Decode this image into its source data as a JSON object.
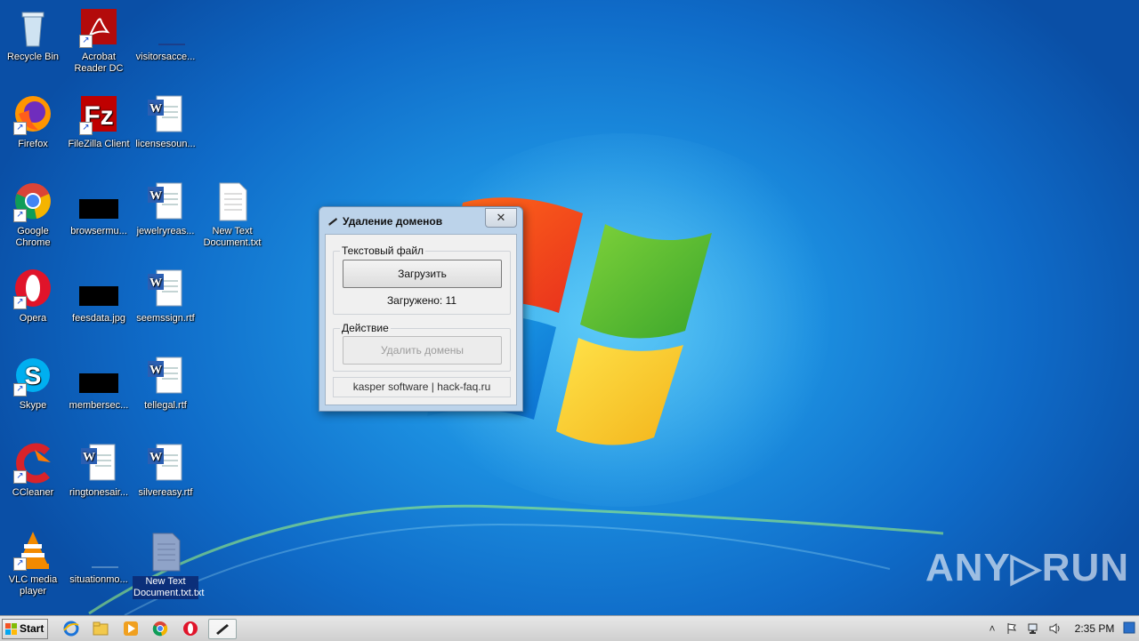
{
  "desktop": {
    "icons": [
      {
        "id": "recycle-bin",
        "label": "Recycle Bin",
        "icon": "recycle-bin-icon",
        "shortcut": false
      },
      {
        "id": "acrobat",
        "label": "Acrobat Reader DC",
        "icon": "acrobat-icon",
        "shortcut": true
      },
      {
        "id": "visitorsacce",
        "label": "visitorsacce...",
        "icon": "blank-file-icon",
        "shortcut": false
      },
      {
        "id": "firefox",
        "label": "Firefox",
        "icon": "firefox-icon",
        "shortcut": true
      },
      {
        "id": "filezilla",
        "label": "FileZilla Client",
        "icon": "filezilla-icon",
        "shortcut": true
      },
      {
        "id": "licensesoun",
        "label": "licensesoun...",
        "icon": "word-doc-icon",
        "shortcut": false
      },
      {
        "id": "chrome",
        "label": "Google Chrome",
        "icon": "chrome-icon",
        "shortcut": true
      },
      {
        "id": "browsermu",
        "label": "browsermu...",
        "icon": "black-image-icon",
        "shortcut": false
      },
      {
        "id": "jewelryreas",
        "label": "jewelryreas...",
        "icon": "word-doc-icon",
        "shortcut": false
      },
      {
        "id": "newtext1",
        "label": "New Text Document.txt",
        "icon": "text-file-icon",
        "shortcut": false
      },
      {
        "id": "opera",
        "label": "Opera",
        "icon": "opera-icon",
        "shortcut": true
      },
      {
        "id": "feesdata",
        "label": "feesdata.jpg",
        "icon": "black-image-icon",
        "shortcut": false
      },
      {
        "id": "seemssign",
        "label": "seemssign.rtf",
        "icon": "word-doc-icon",
        "shortcut": false
      },
      {
        "id": "skype",
        "label": "Skype",
        "icon": "skype-icon",
        "shortcut": true
      },
      {
        "id": "membersec",
        "label": "membersec...",
        "icon": "black-image-icon",
        "shortcut": false
      },
      {
        "id": "tellegal",
        "label": "tellegal.rtf",
        "icon": "word-doc-icon",
        "shortcut": false
      },
      {
        "id": "ccleaner",
        "label": "CCleaner",
        "icon": "ccleaner-icon",
        "shortcut": true
      },
      {
        "id": "ringtonesair",
        "label": "ringtonesair...",
        "icon": "word-doc-icon",
        "shortcut": false
      },
      {
        "id": "silvereasy",
        "label": "silvereasy.rtf",
        "icon": "word-doc-icon",
        "shortcut": false
      },
      {
        "id": "vlc",
        "label": "VLC media player",
        "icon": "vlc-icon",
        "shortcut": true
      },
      {
        "id": "situationmo",
        "label": "situationmo...",
        "icon": "blank-file-icon",
        "shortcut": false
      },
      {
        "id": "newtext2",
        "label": "New Text Document.txt.txt",
        "icon": "text-file-icon",
        "shortcut": false,
        "selected": true
      }
    ]
  },
  "dialog": {
    "title": "Удаление доменов",
    "close_glyph": "✕",
    "group_file": {
      "legend": "Текстовый файл",
      "load_button": "Загрузить",
      "status": "Загружено: 11"
    },
    "group_action": {
      "legend": "Действие",
      "delete_button": "Удалить домены"
    },
    "credits": "kasper software | hack-faq.ru"
  },
  "watermark": {
    "text": "ANY▷RUN"
  },
  "taskbar": {
    "start_label": "Start",
    "pinned": [
      "internet-explorer-icon",
      "folder-icon",
      "media-player-icon",
      "chrome-icon",
      "opera-icon",
      "app-window-icon"
    ],
    "tray": {
      "clock": "2:35 PM"
    }
  }
}
